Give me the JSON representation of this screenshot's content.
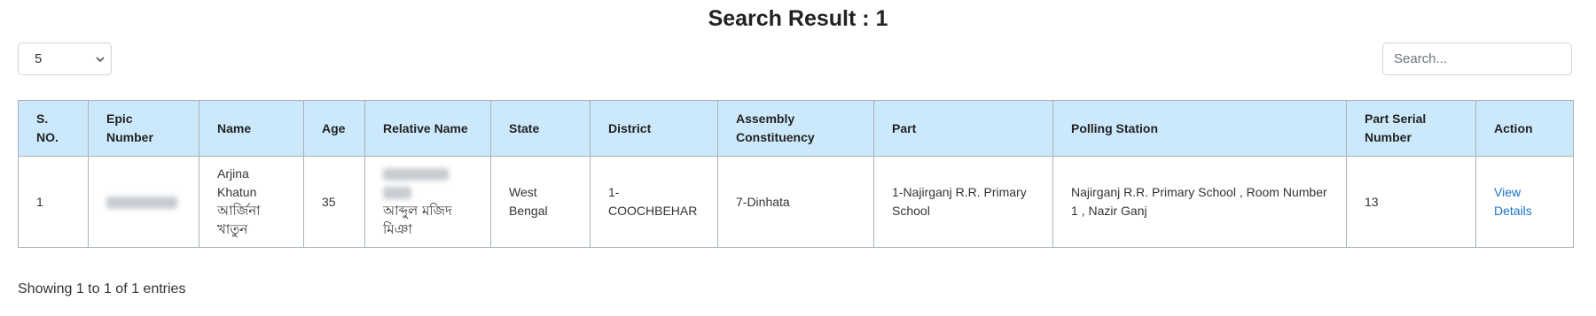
{
  "title": "Search Result : 1",
  "controls": {
    "page_length": "5",
    "search_placeholder": "Search..."
  },
  "table": {
    "headers": {
      "sno_line1": "S.",
      "sno_line2": "NO.",
      "epic": "Epic Number",
      "name": "Name",
      "age": "Age",
      "relative": "Relative Name",
      "state": "State",
      "district": "District",
      "ac_line1": "Assembly",
      "ac_line2": "Constituency",
      "part": "Part",
      "polling": "Polling Station",
      "serial_line1": "Part Serial",
      "serial_line2": "Number",
      "action": "Action"
    },
    "rows": [
      {
        "sno": "1",
        "name_en_1": "Arjina",
        "name_en_2": "Khatun",
        "name_bn_1": "আর্জিনা",
        "name_bn_2": "খাতুন",
        "age": "35",
        "relative_bn_1": "আব্দুল মজিদ",
        "relative_bn_2": "মিঞা",
        "state_1": "West",
        "state_2": "Bengal",
        "district_1": "1-",
        "district_2": "COOCHBEHAR",
        "ac": "7-Dinhata",
        "part_1": "1-Najirganj R.R. Primary",
        "part_2": "School",
        "polling_1": "Najirganj R.R. Primary School , Room Number",
        "polling_2": "1 , Nazir Ganj",
        "serial": "13",
        "action_1": "View",
        "action_2": "Details"
      }
    ]
  },
  "footer": {
    "info": "Showing 1 to 1 of 1 entries"
  }
}
